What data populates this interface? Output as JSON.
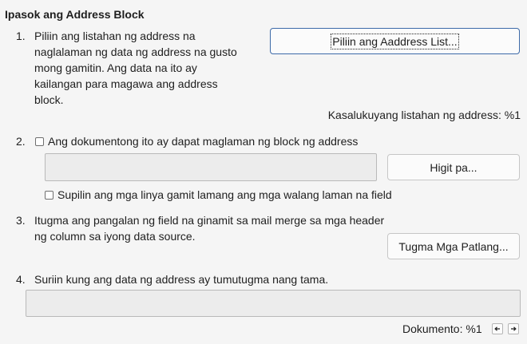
{
  "section_title": "Ipasok ang Address Block",
  "step1": {
    "number": "1.",
    "text": "Piliin ang listahan ng address na naglalaman ng data ng address na gusto mong gamitin. Ang data na ito ay kailangan para magawa ang address block.",
    "button_label": "Piliin ang Aaddress List...",
    "current_list_label": "Kasalukuyang listahan ng address: %1"
  },
  "step2": {
    "number": "2.",
    "checkbox_label": "Ang dokumentong ito ay dapat maglaman ng block ng address",
    "checkbox_checked": false,
    "more_button_label": "Higit pa...",
    "suppress_checkbox_label": "Supilin ang mga linya gamit lamang ang mga walang laman na field",
    "suppress_checked": false
  },
  "step3": {
    "number": "3.",
    "text": "Itugma ang pangalan ng field na ginamit sa mail merge sa mga header ng column sa iyong data source.",
    "button_label": "Tugma Mga Patlang..."
  },
  "step4": {
    "number": "4.",
    "text": "Suriin kung ang data ng address ay tumutugma nang tama.",
    "document_label": "Dokumento: %1"
  },
  "icons": {
    "prev": "arrow-left-icon",
    "next": "arrow-right-icon"
  }
}
